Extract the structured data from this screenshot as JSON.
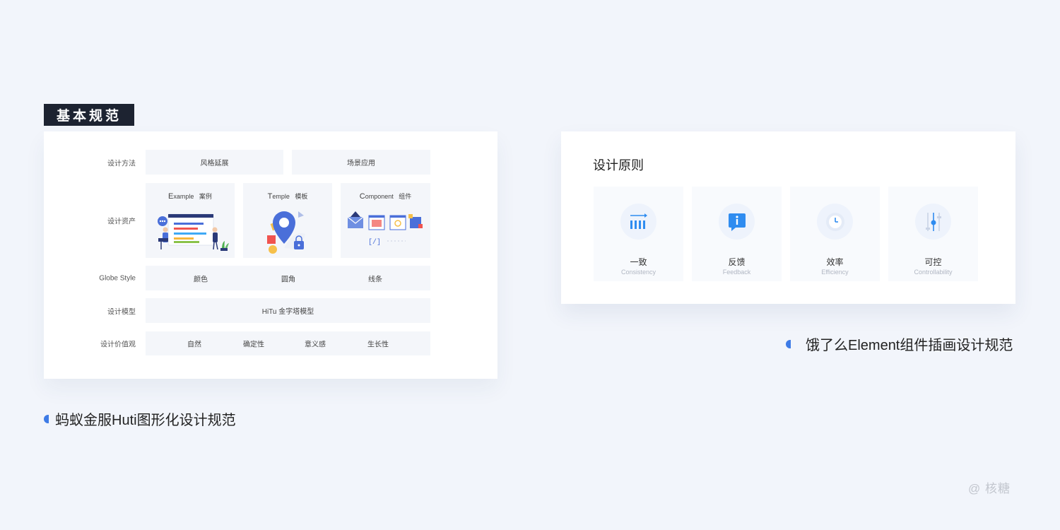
{
  "left": {
    "tag": "基本规范",
    "rows": {
      "method": {
        "label": "设计方法",
        "items": [
          "风格延展",
          "场景应用"
        ]
      },
      "assets": {
        "label": "设计资产",
        "items": [
          {
            "initial": "E",
            "rest": "xample",
            "cn": "案例"
          },
          {
            "initial": "T",
            "rest": "emple",
            "cn": "模板"
          },
          {
            "initial": "C",
            "rest": "omponent",
            "cn": "组件"
          }
        ]
      },
      "globe": {
        "label": "Globe Style",
        "items": [
          "颜色",
          "圆角",
          "线条"
        ]
      },
      "model": {
        "label": "设计模型",
        "value": "HiTu 金字塔模型"
      },
      "values": {
        "label": "设计价值观",
        "items": [
          "自然",
          "确定性",
          "意义感",
          "生长性"
        ]
      }
    },
    "caption": "蚂蚁金服Huti图形化设计规范"
  },
  "right": {
    "title": "设计原则",
    "principles": [
      {
        "title": "一致",
        "subtitle": "Consistency",
        "icon": "consistency-icon"
      },
      {
        "title": "反馈",
        "subtitle": "Feedback",
        "icon": "feedback-icon"
      },
      {
        "title": "效率",
        "subtitle": "Efficiency",
        "icon": "efficiency-icon"
      },
      {
        "title": "可控",
        "subtitle": "Controllability",
        "icon": "controllability-icon"
      }
    ],
    "caption": "饿了么Element组件插画设计规范"
  },
  "watermark": "@ 核糖",
  "colors": {
    "accent": "#3e7be6",
    "tag_bg": "#1d2331",
    "cell_bg": "#f4f6fa",
    "page_bg": "#f2f5fb"
  }
}
